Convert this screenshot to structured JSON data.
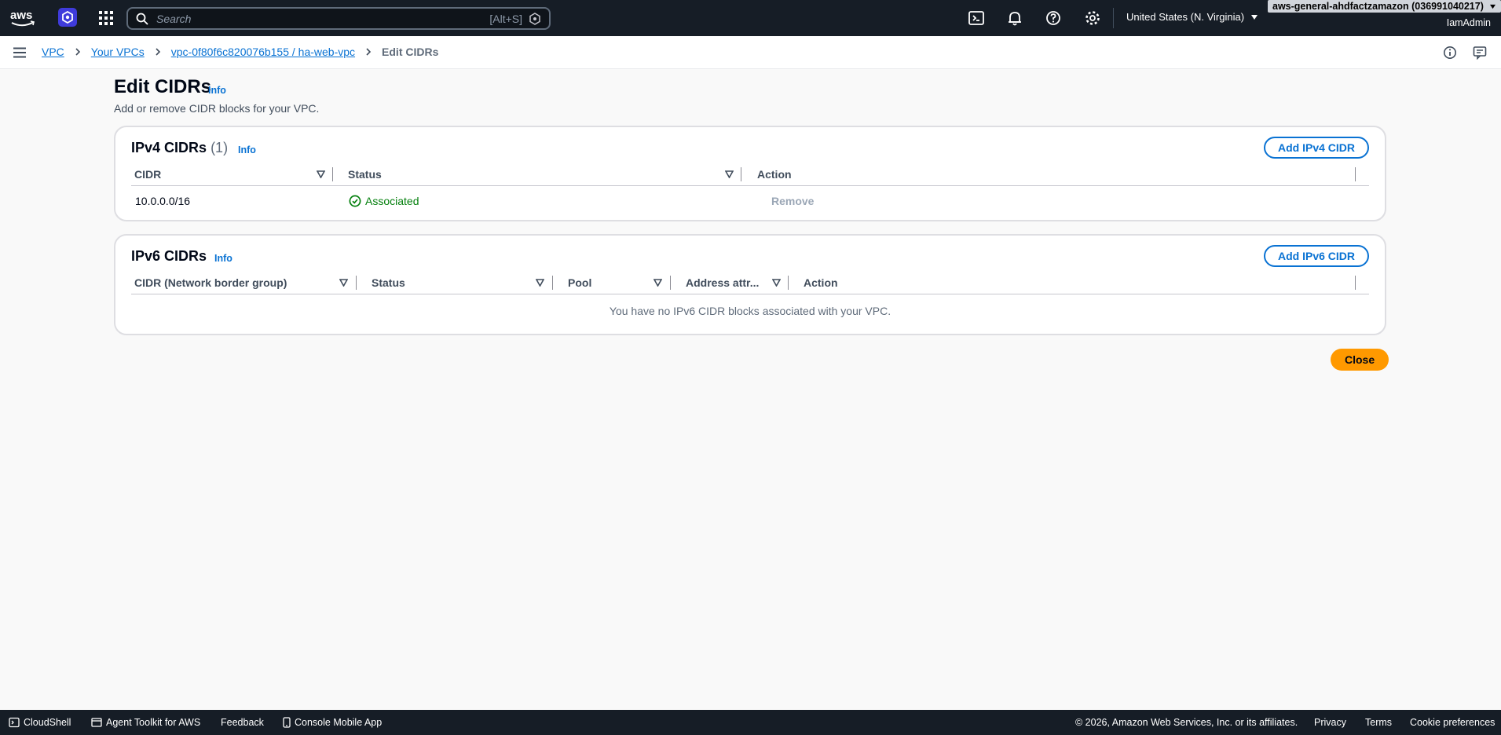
{
  "topnav": {
    "search_placeholder": "Search",
    "search_shortcut": "[Alt+S]",
    "region": "United States (N. Virginia)",
    "account": "aws-general-ahdfactzamazon (036991040217)",
    "user": "IamAdmin"
  },
  "breadcrumb": {
    "items": [
      "VPC",
      "Your VPCs",
      "vpc-0f80f6c820076b155 / ha-web-vpc"
    ],
    "current": "Edit CIDRs"
  },
  "page": {
    "title": "Edit CIDRs",
    "info": "Info",
    "description": "Add or remove CIDR blocks for your VPC."
  },
  "ipv4": {
    "title": "IPv4 CIDRs",
    "count": "(1)",
    "info": "Info",
    "add_button": "Add IPv4 CIDR",
    "columns": [
      "CIDR",
      "Status",
      "Action"
    ],
    "rows": [
      {
        "cidr": "10.0.0.0/16",
        "status": "Associated",
        "action": "Remove"
      }
    ]
  },
  "ipv6": {
    "title": "IPv6 CIDRs",
    "info": "Info",
    "add_button": "Add IPv6 CIDR",
    "columns": [
      "CIDR (Network border group)",
      "Status",
      "Pool",
      "Address attr...",
      "Action"
    ],
    "empty": "You have no IPv6 CIDR blocks associated with your VPC."
  },
  "actions": {
    "close": "Close"
  },
  "footer": {
    "cloudshell": "CloudShell",
    "agent_toolkit": "Agent Toolkit for AWS",
    "feedback": "Feedback",
    "mobile_app": "Console Mobile App",
    "copyright": "© 2026, Amazon Web Services, Inc. or its affiliates.",
    "privacy": "Privacy",
    "terms": "Terms",
    "cookies": "Cookie preferences"
  },
  "colors": {
    "nav_bg": "#161d26",
    "link": "#0972d3",
    "success": "#037f0c",
    "primary": "#ff9900"
  },
  "icons": [
    "aws-logo",
    "app-logo-icon",
    "apps-grid-icon",
    "search-icon",
    "cloudshell-icon",
    "notifications-icon",
    "help-icon",
    "settings-icon",
    "caret-down-icon",
    "menu-icon",
    "info-icon",
    "feedback-panel-icon",
    "sort-icon",
    "check-circle-icon"
  ]
}
